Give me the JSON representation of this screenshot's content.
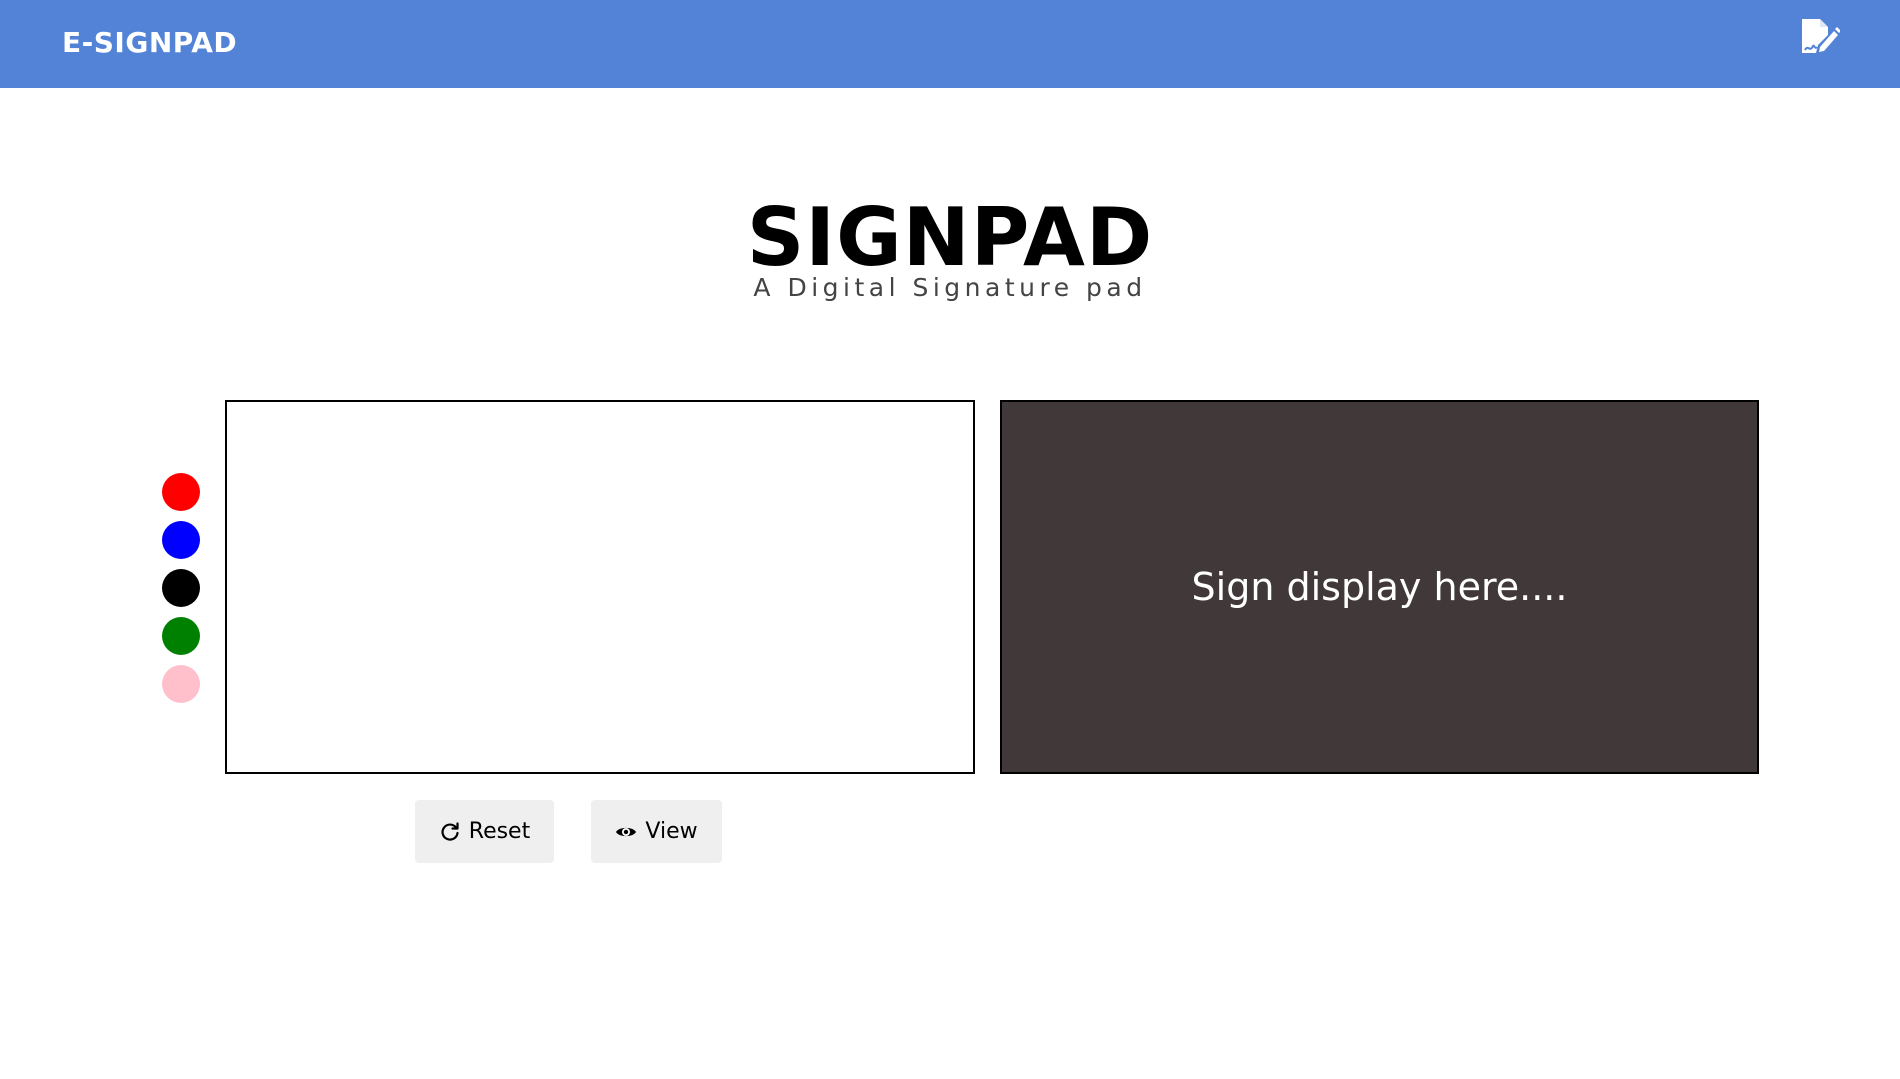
{
  "header": {
    "brand": "E-SIGNPAD",
    "icon": "signature-edit-icon"
  },
  "hero": {
    "title": "SIGNPAD",
    "subtitle": "A Digital Signature pad"
  },
  "palette": {
    "colors": [
      "#ff0000",
      "#0000ff",
      "#000000",
      "#008000",
      "#ffc0cb"
    ],
    "names": [
      "red",
      "blue",
      "black",
      "green",
      "pink"
    ]
  },
  "display": {
    "placeholder": "Sign display here....",
    "background": "#403839"
  },
  "buttons": {
    "reset_label": "Reset",
    "reset_icon": "refresh-icon",
    "view_label": "View",
    "view_icon": "eye-icon"
  },
  "colors": {
    "header_bg": "#5383d6",
    "button_bg": "#efefef"
  }
}
